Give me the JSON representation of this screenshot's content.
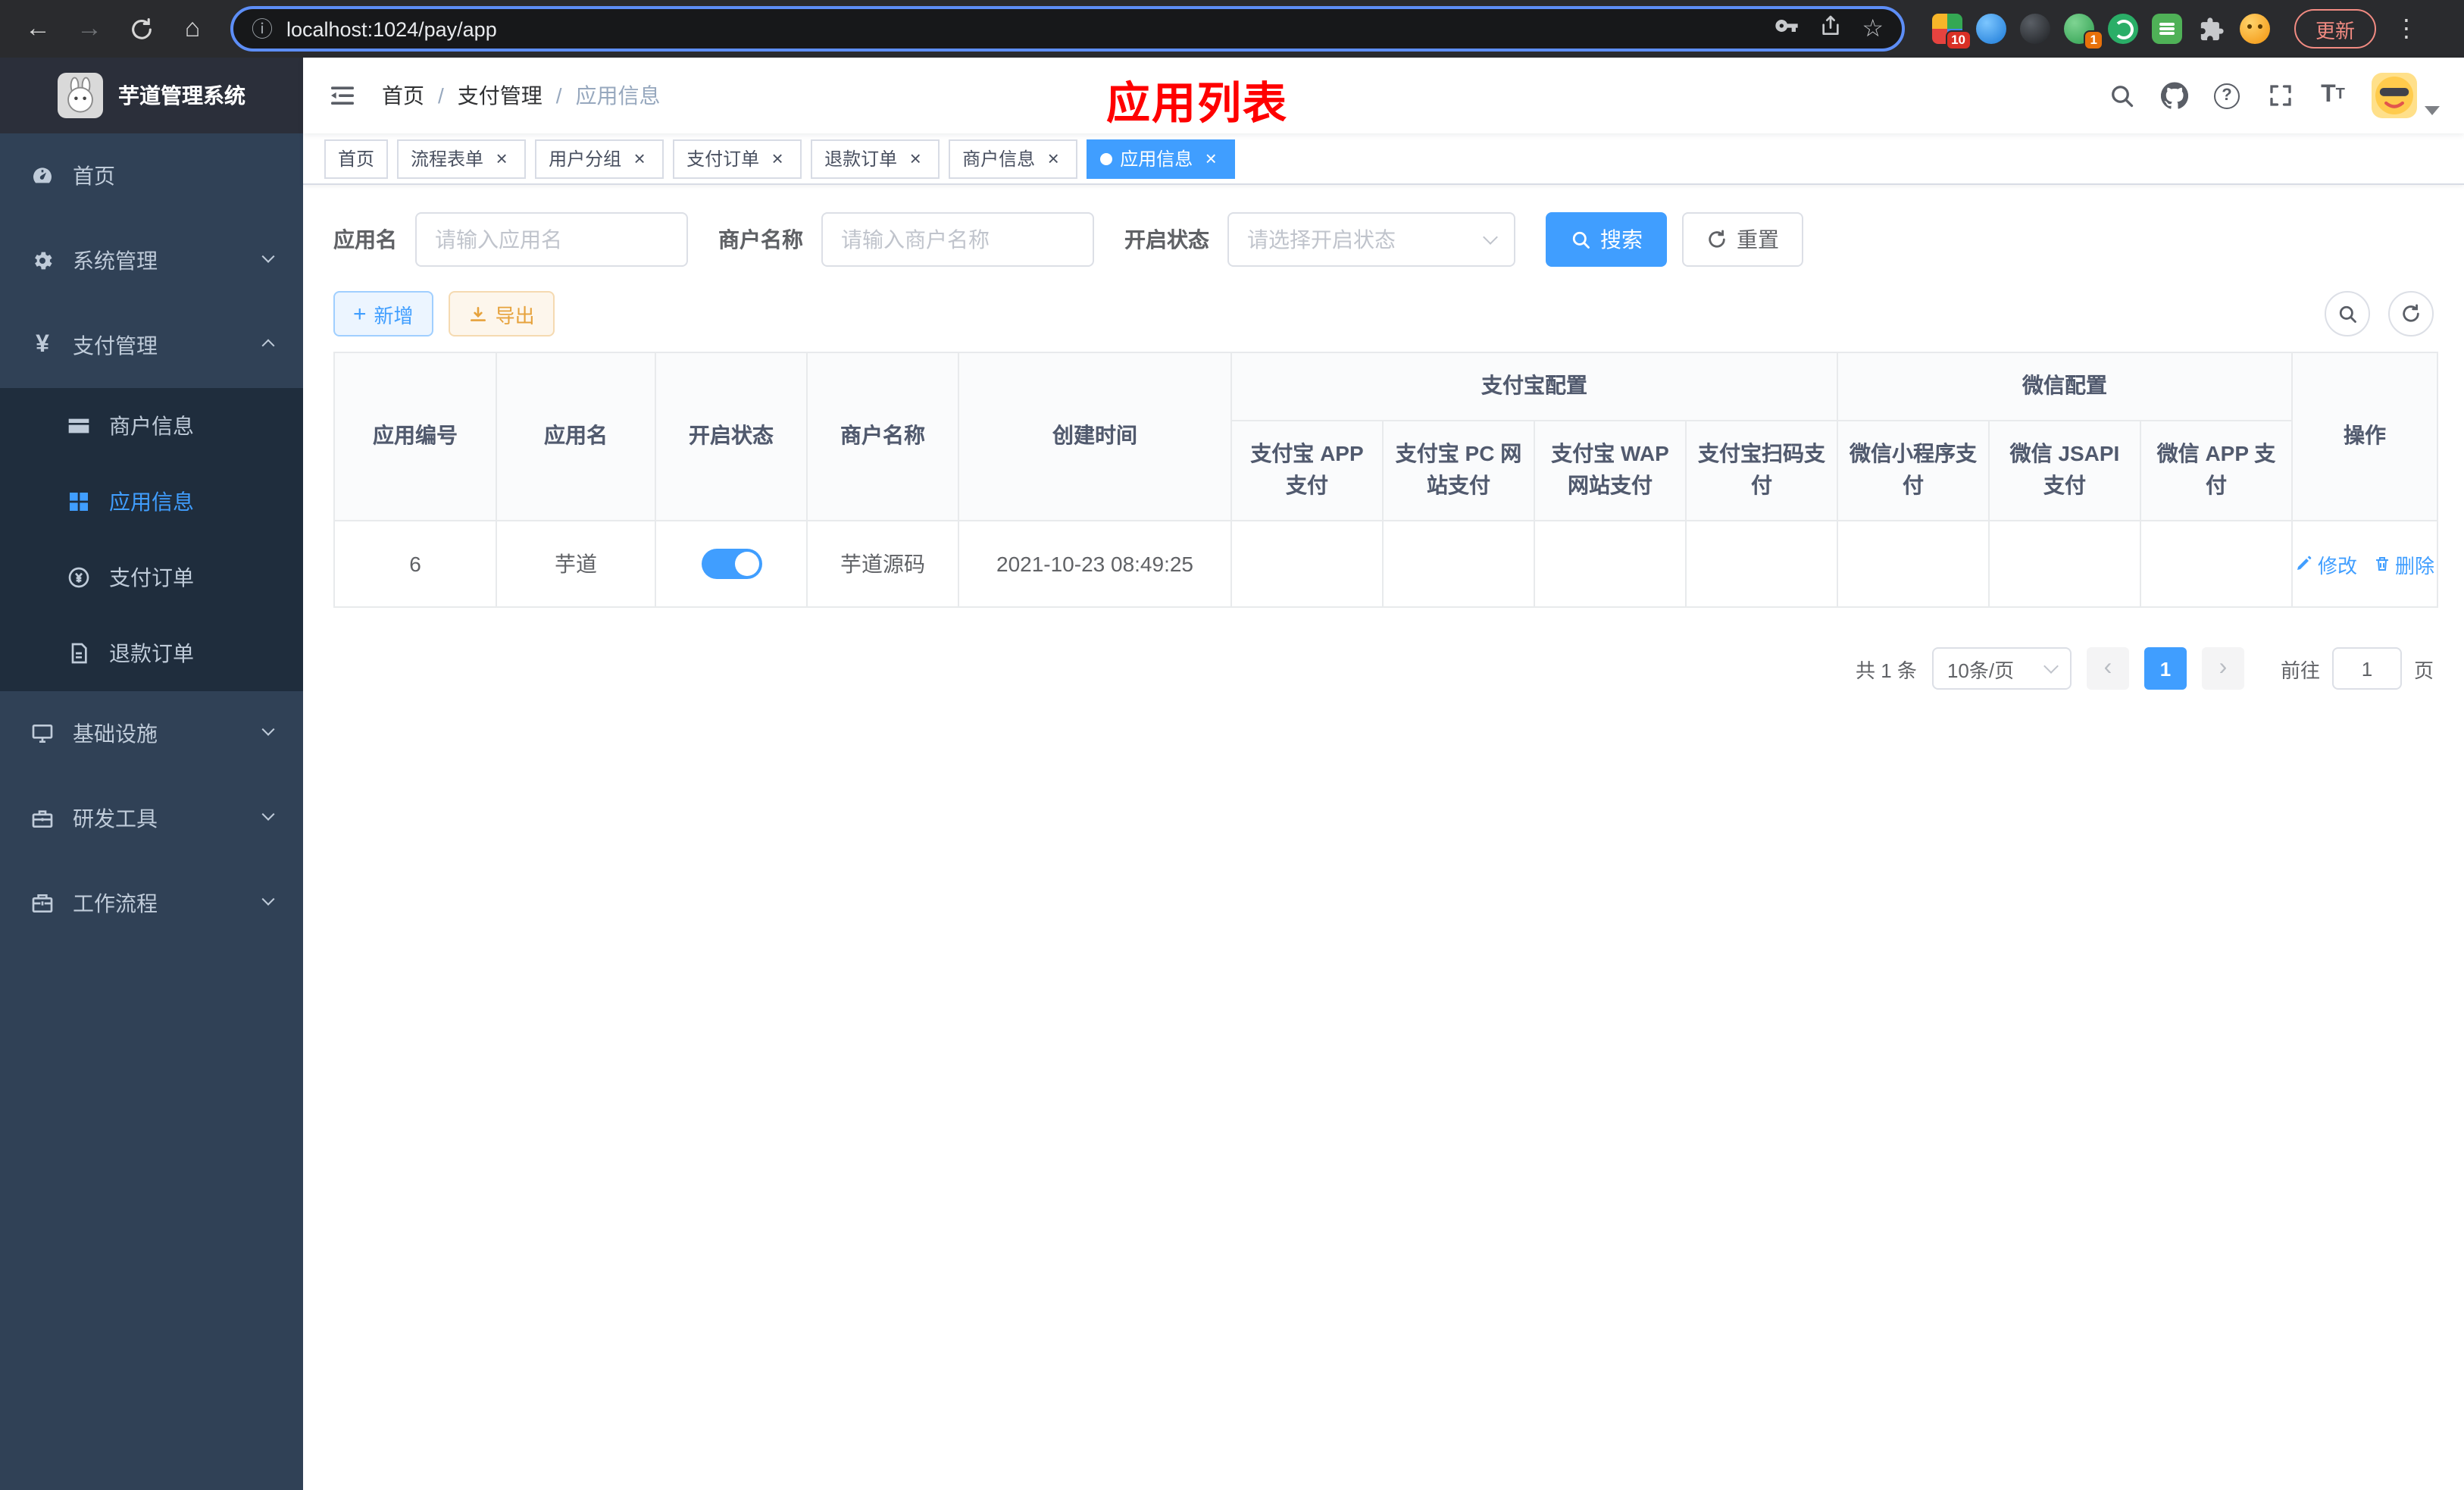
{
  "colors": {
    "primary": "#409EFF",
    "success": "#13ce66",
    "danger": "#f45151",
    "warning": "#e6a23c",
    "title_red": "#ff0000"
  },
  "icons": {
    "back": "←",
    "forward": "→",
    "home": "⌂",
    "info": "ⓘ",
    "star": "☆",
    "kebab": "⋮",
    "question": "?",
    "font_large": "T",
    "font_small": "T",
    "plus": "+",
    "close": "×",
    "prev": "‹",
    "next": "›",
    "yen": "¥"
  },
  "browser": {
    "url": "localhost:1024/pay/app",
    "update_label": "更新",
    "ext_badge_colorful": "10",
    "ext_badge_green": "1"
  },
  "sidebar": {
    "app_title": "芋道管理系统",
    "menu": [
      {
        "label": "首页"
      },
      {
        "label": "系统管理"
      },
      {
        "label": "支付管理",
        "children": [
          {
            "label": "商户信息"
          },
          {
            "label": "应用信息"
          },
          {
            "label": "支付订单"
          },
          {
            "label": "退款订单"
          }
        ]
      },
      {
        "label": "基础设施"
      },
      {
        "label": "研发工具"
      },
      {
        "label": "工作流程"
      }
    ]
  },
  "header": {
    "breadcrumb": [
      "首页",
      "支付管理",
      "应用信息"
    ],
    "page_title": "应用列表"
  },
  "tabs": [
    {
      "label": "首页"
    },
    {
      "label": "流程表单"
    },
    {
      "label": "用户分组"
    },
    {
      "label": "支付订单"
    },
    {
      "label": "退款订单"
    },
    {
      "label": "商户信息"
    },
    {
      "label": "应用信息"
    }
  ],
  "filters": {
    "app_name": {
      "label": "应用名",
      "placeholder": "请输入应用名",
      "value": ""
    },
    "merchant_name": {
      "label": "商户名称",
      "placeholder": "请输入商户名称",
      "value": ""
    },
    "status": {
      "label": "开启状态",
      "placeholder": "请选择开启状态",
      "value": ""
    },
    "search_label": "搜索",
    "reset_label": "重置"
  },
  "toolbar": {
    "add_label": "新增",
    "export_label": "导出"
  },
  "table": {
    "group_headers": {
      "alipay": "支付宝配置",
      "wechat": "微信配置"
    },
    "columns": {
      "app_id": "应用编号",
      "app_name": "应用名",
      "status": "开启状态",
      "merchant_name": "商户名称",
      "create_time": "创建时间",
      "alipay_app": "支付宝 APP 支付",
      "alipay_pc": "支付宝 PC 网站支付",
      "alipay_wap": "支付宝 WAP 网站支付",
      "alipay_qr": "支付宝扫码支付",
      "wx_lite": "微信小程序支付",
      "wx_jsapi": "微信 JSAPI 支付",
      "wx_app": "微信 APP 支付",
      "actions": "操作"
    },
    "rows": [
      {
        "app_id": "6",
        "app_name": "芋道",
        "status_on": true,
        "merchant_name": "芋道源码",
        "create_time": "2021-10-23 08:49:25",
        "alipay_app": "disabled",
        "alipay_pc": "disabled",
        "alipay_wap": "disabled",
        "alipay_qr": "disabled",
        "wx_lite": "disabled",
        "wx_jsapi": "enabled",
        "wx_app": "disabled",
        "edit_label": "修改",
        "delete_label": "删除"
      }
    ]
  },
  "pagination": {
    "total_text": "共 1 条",
    "page_size": "10条/页",
    "current_page": "1",
    "goto_label": "前往",
    "goto_value": "1",
    "page_unit": "页"
  }
}
